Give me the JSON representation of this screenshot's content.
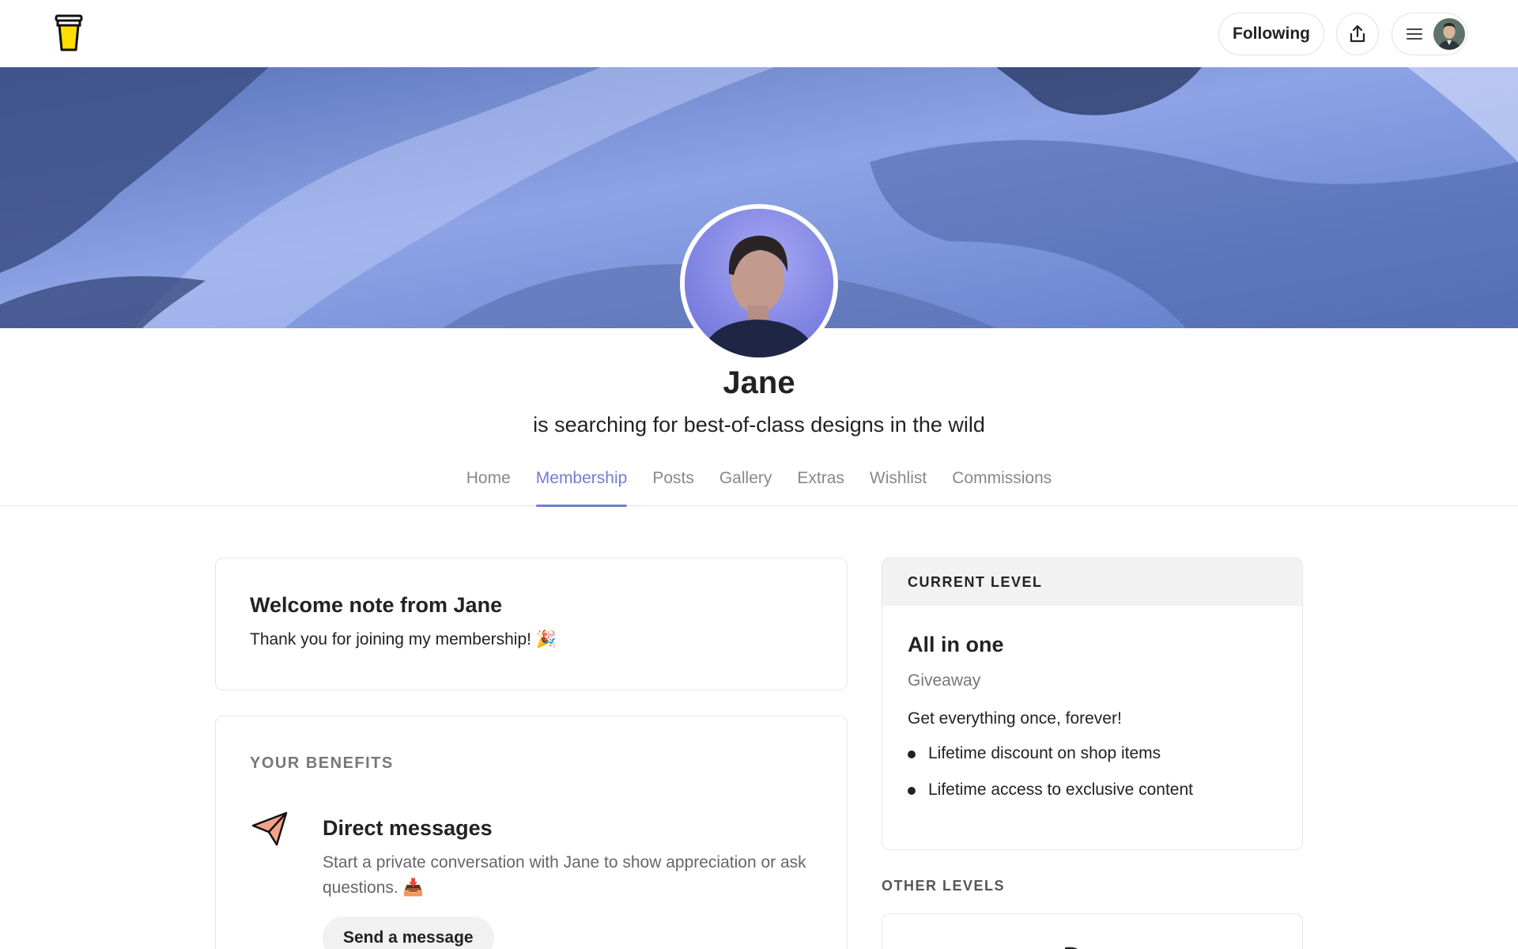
{
  "header": {
    "following_label": "Following"
  },
  "profile": {
    "name": "Jane",
    "tagline": "is searching for best-of-class designs in the wild"
  },
  "tabs": [
    {
      "label": "Home",
      "active": false
    },
    {
      "label": "Membership",
      "active": true
    },
    {
      "label": "Posts",
      "active": false
    },
    {
      "label": "Gallery",
      "active": false
    },
    {
      "label": "Extras",
      "active": false
    },
    {
      "label": "Wishlist",
      "active": false
    },
    {
      "label": "Commissions",
      "active": false
    }
  ],
  "welcome": {
    "title": "Welcome note from Jane",
    "text": "Thank you for joining my membership! 🎉"
  },
  "benefits": {
    "section_label": "YOUR BENEFITS",
    "items": [
      {
        "title": "Direct messages",
        "description": "Start a private conversation with Jane to show appreciation or ask questions. 📥",
        "button_label": "Send a message"
      }
    ]
  },
  "current_level": {
    "header": "CURRENT LEVEL",
    "name": "All in one",
    "subtitle": "Giveaway",
    "description": "Get everything once, forever!",
    "perks": [
      "Lifetime discount on shop items",
      "Lifetime access to exclusive content"
    ]
  },
  "other_levels": {
    "label": "OTHER LEVELS"
  },
  "colors": {
    "accent": "#717dd1",
    "cover": "#6f86cf",
    "logo_yellow": "#ffdd00"
  }
}
